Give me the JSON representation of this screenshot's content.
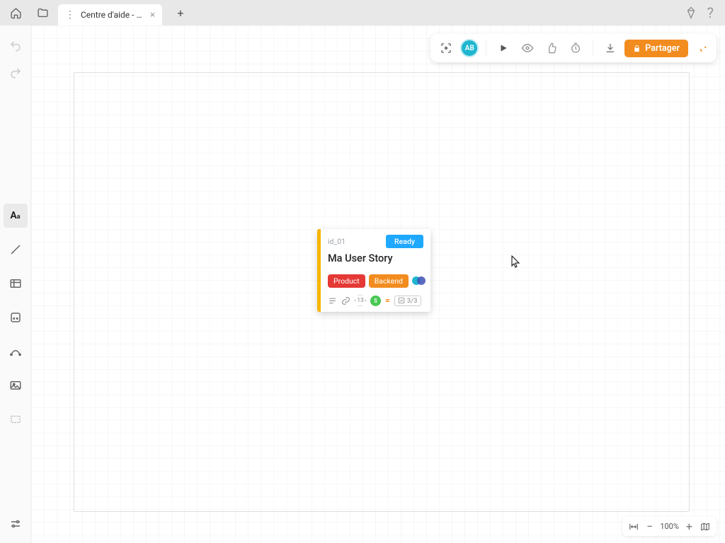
{
  "tabs": {
    "active_label": "Centre d'aide - Cu…"
  },
  "avatar_initials": "AB",
  "share_button_label": "Partager",
  "card": {
    "id_text": "id_01",
    "status": "Ready",
    "title": "Ma User Story",
    "tag_product": "Product",
    "tag_backend": "Backend",
    "points": "13",
    "assignee_initial": "S",
    "priority_glyph": "=",
    "checklist": "3/3"
  },
  "zoom": {
    "level": "100%"
  }
}
